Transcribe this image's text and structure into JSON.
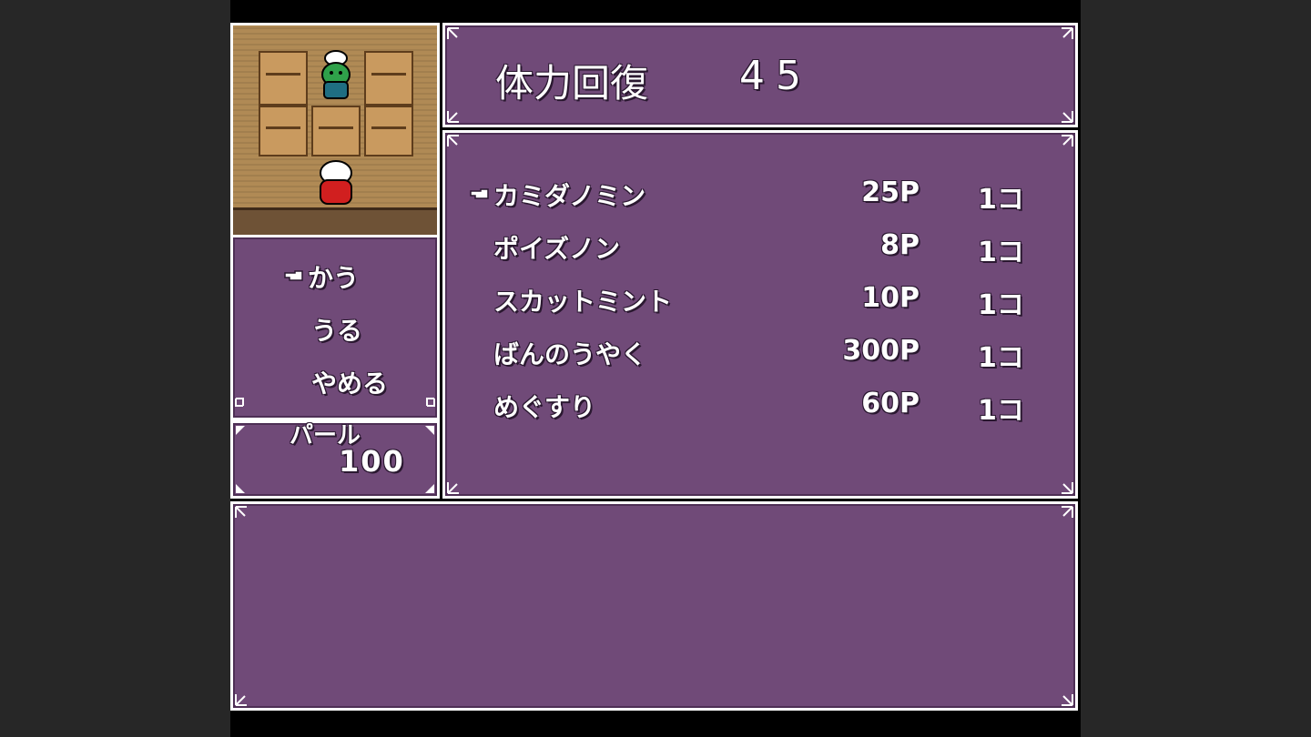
{
  "status": {
    "label": "体力回復",
    "value": "45"
  },
  "shop_menu": {
    "items": [
      {
        "label": "かう",
        "selected": true
      },
      {
        "label": "うる",
        "selected": false
      },
      {
        "label": "やめる",
        "selected": false
      }
    ]
  },
  "money": {
    "label": "パール",
    "value": "100"
  },
  "item_list": [
    {
      "name": "カミダノミン",
      "price": "25P",
      "qty": "1コ",
      "selected": true
    },
    {
      "name": "ポイズノン",
      "price": "8P",
      "qty": "1コ",
      "selected": false
    },
    {
      "name": "スカットミント",
      "price": "10P",
      "qty": "1コ",
      "selected": false
    },
    {
      "name": "ばんのうやく",
      "price": "300P",
      "qty": "1コ",
      "selected": false
    },
    {
      "name": "めぐすり",
      "price": "60P",
      "qty": "1コ",
      "selected": false
    }
  ],
  "message": "",
  "colors": {
    "window_bg": "#704a78",
    "window_border": "#ffffff",
    "outer_bg": "#272727"
  },
  "icons": {
    "cursor": "pointing-hand-icon"
  }
}
